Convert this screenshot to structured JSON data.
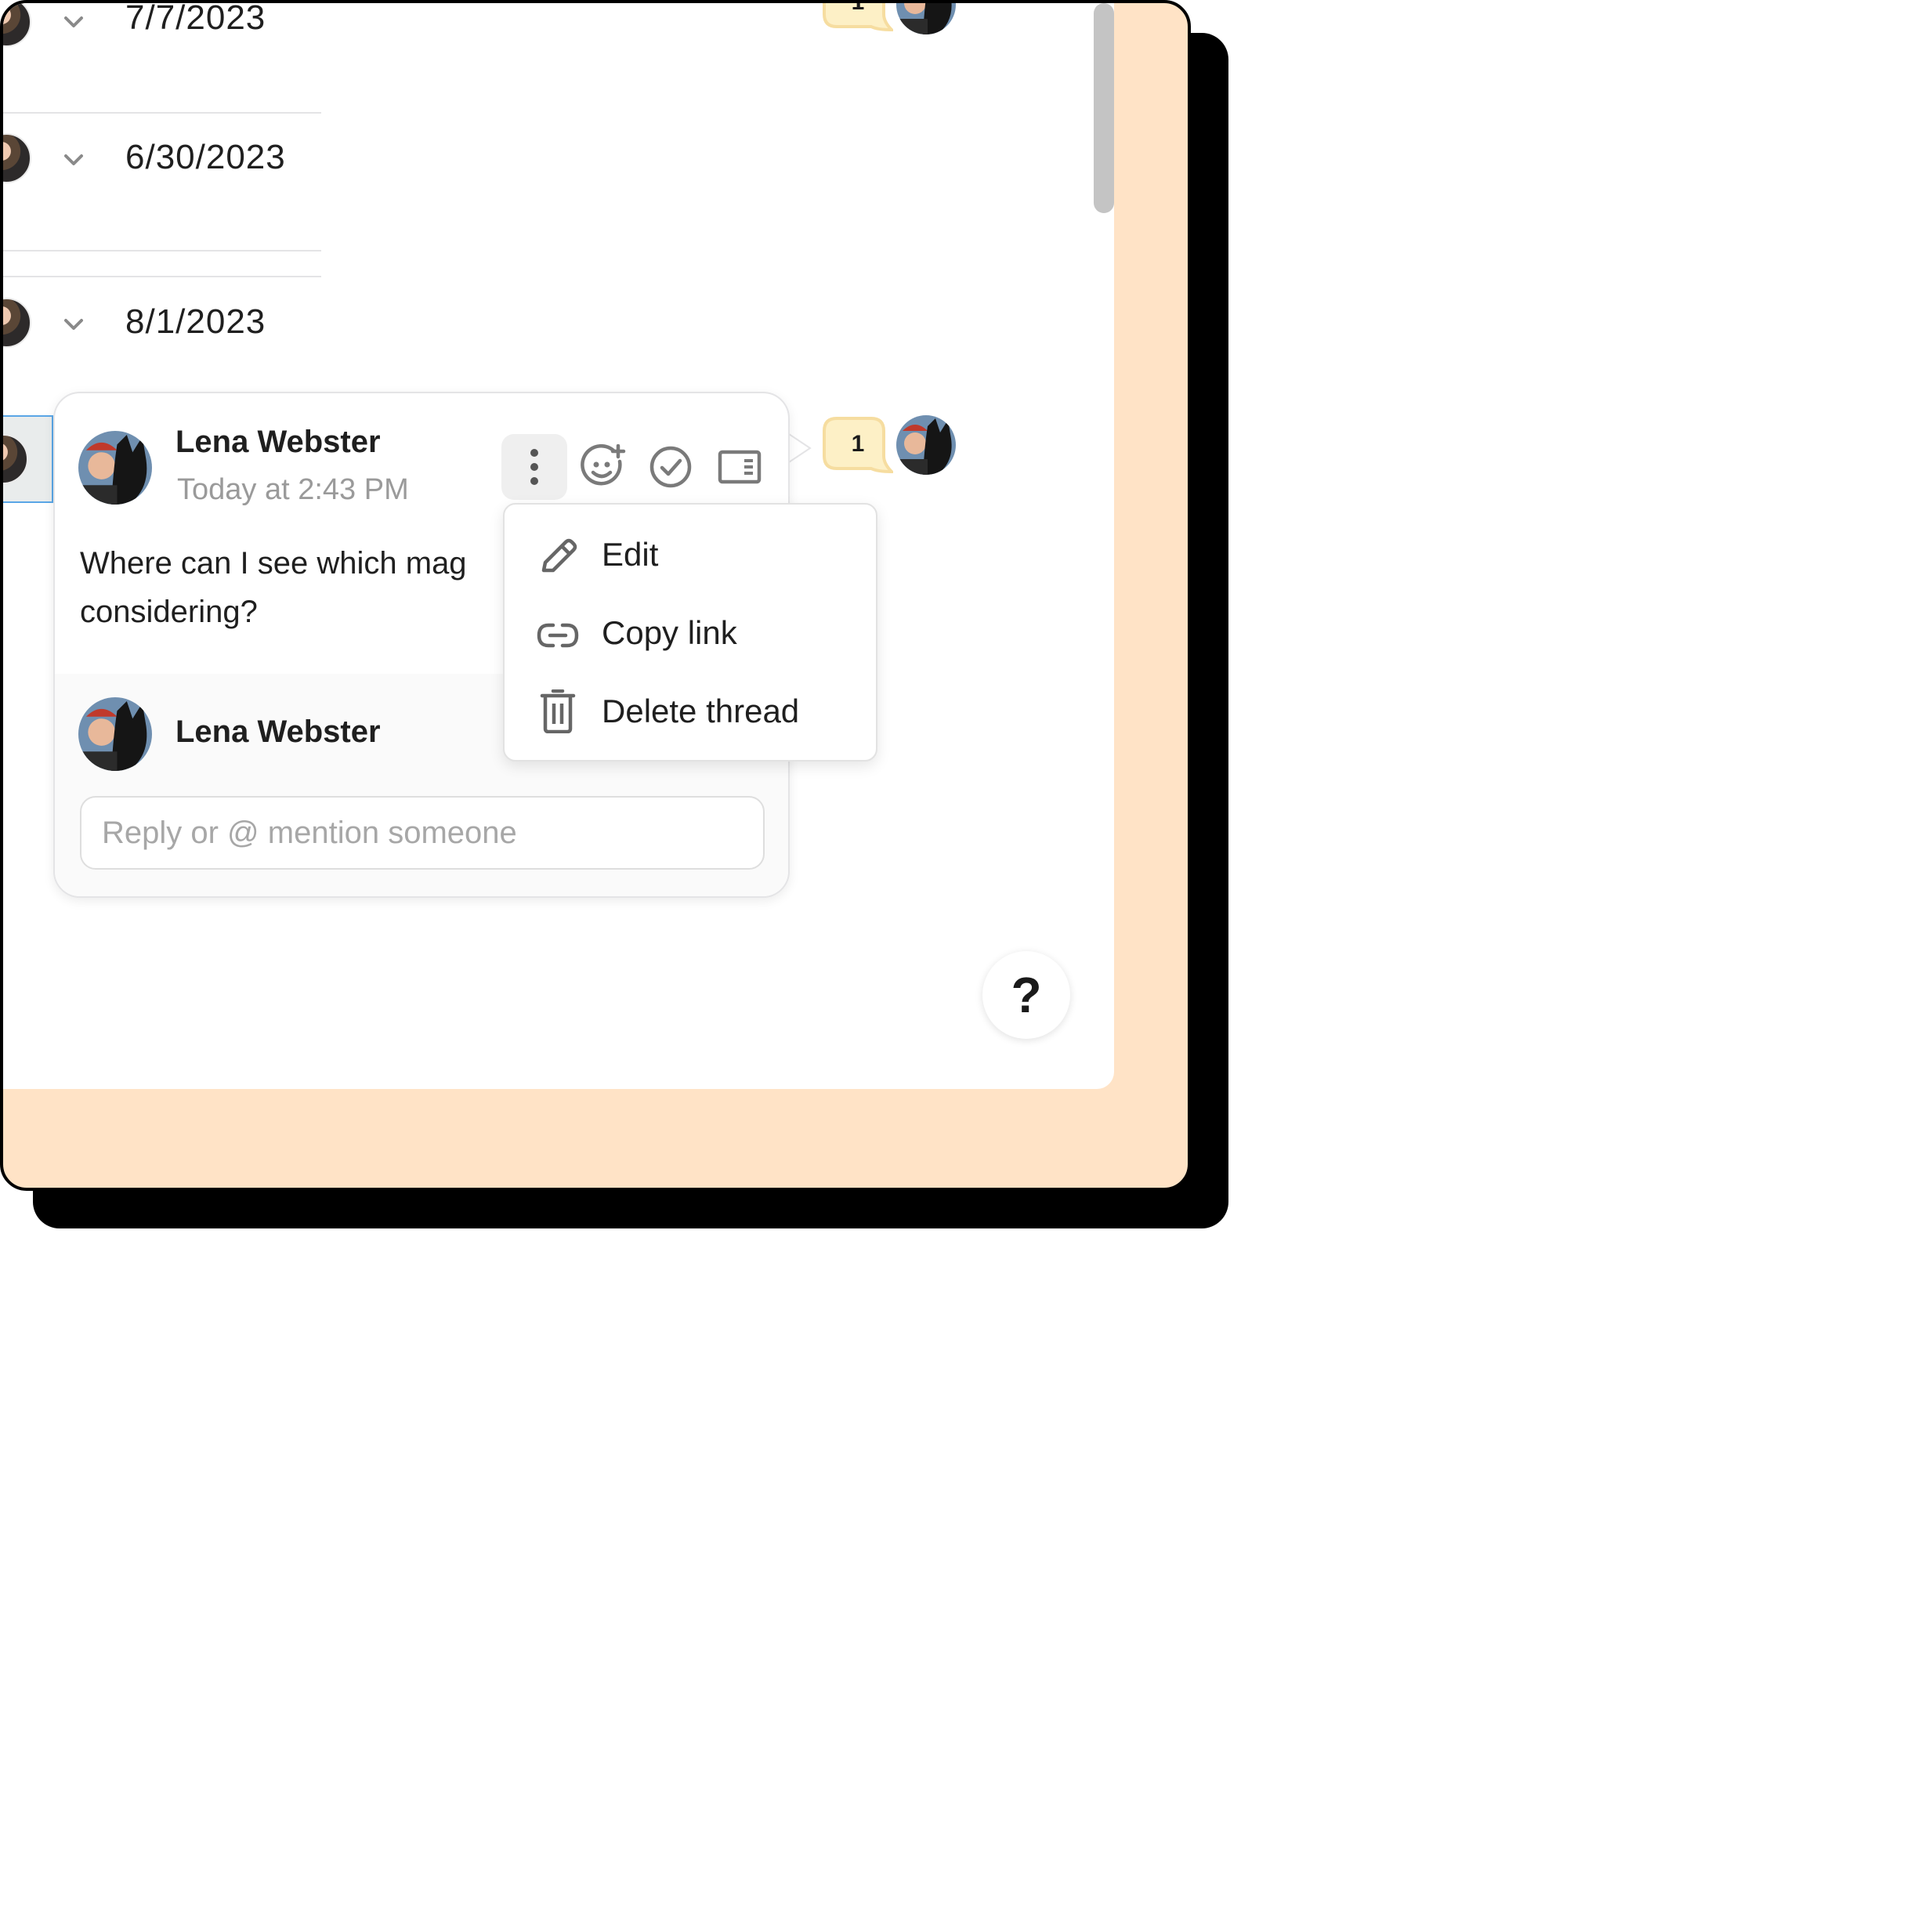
{
  "rows": [
    {
      "date": "7/7/2023",
      "comment_count": "1"
    },
    {
      "date": "6/30/2023"
    },
    {
      "date": "8/1/2023",
      "comment_count": "1"
    }
  ],
  "thread": {
    "author": "Lena Webster",
    "timestamp": "Today at 2:43 PM",
    "body_line1": "Where can I see which mag",
    "body_line2": "considering?",
    "reply_author": "Lena Webster",
    "reply_placeholder": "Reply or @ mention someone"
  },
  "toolbar_icons": [
    "more-options-icon",
    "add-reaction-icon",
    "resolve-check-icon",
    "open-sidebar-icon"
  ],
  "context_menu": {
    "items": [
      {
        "label": "Edit",
        "icon": "pencil-icon"
      },
      {
        "label": "Copy link",
        "icon": "link-icon"
      },
      {
        "label": "Delete thread",
        "icon": "trash-icon"
      }
    ]
  },
  "help": {
    "label": "?"
  },
  "colors": {
    "frame_background": "#ffe3c6",
    "badge_fill": "#fdf0c6",
    "badge_border": "#f6dda0",
    "selection_border": "#5aa6e6"
  }
}
